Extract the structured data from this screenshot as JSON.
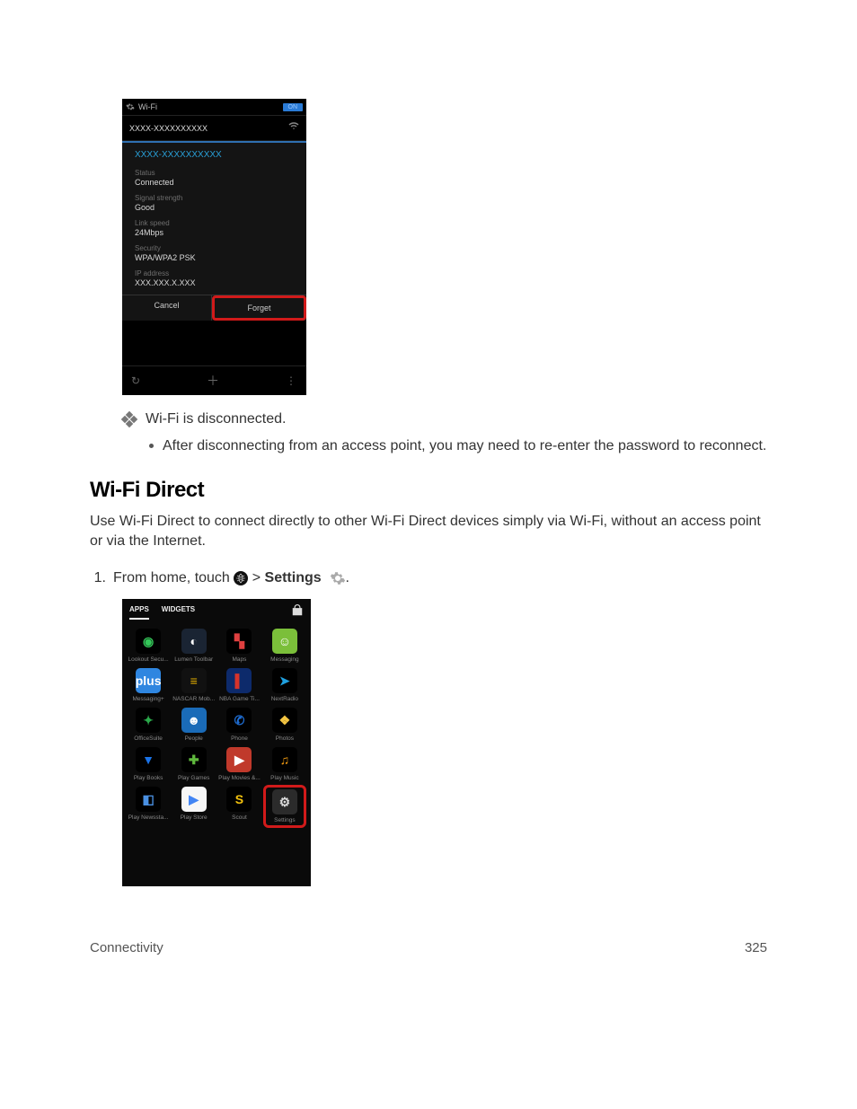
{
  "shot1": {
    "title": "Wi-Fi",
    "toggle": "ON",
    "network_name": "XXXX-XXXXXXXXXX",
    "dialog_title": "XXXX-XXXXXXXXXX",
    "fields": {
      "status_label": "Status",
      "status_value": "Connected",
      "signal_label": "Signal strength",
      "signal_value": "Good",
      "link_label": "Link speed",
      "link_value": "24Mbps",
      "security_label": "Security",
      "security_value": "WPA/WPA2 PSK",
      "ip_label": "IP address",
      "ip_value": "XXX.XXX.X.XXX"
    },
    "cancel": "Cancel",
    "forget": "Forget"
  },
  "result_text": "Wi-Fi is disconnected.",
  "bullet_text": "After disconnecting from an access point, you may need to re-enter the password to reconnect.",
  "section_heading": "Wi-Fi Direct",
  "section_para": "Use Wi-Fi Direct to connect directly to other Wi-Fi Direct devices simply via Wi-Fi, without an access point or via the Internet.",
  "step1": {
    "num": "1.",
    "pre": "From home, touch ",
    "gt": " > ",
    "settings": "Settings",
    "post": "."
  },
  "shot2": {
    "tab_apps": "APPS",
    "tab_widgets": "WIDGETS",
    "apps": [
      {
        "label": "Lookout Secu...",
        "bg": "#000",
        "fg": "#34c759",
        "glyph": "◉"
      },
      {
        "label": "Lumen Toolbar",
        "bg": "#1a2433",
        "fg": "#fff",
        "glyph": "◐"
      },
      {
        "label": "Maps",
        "bg": "#000",
        "fg": "#e04040",
        "glyph": "▚"
      },
      {
        "label": "Messaging",
        "bg": "#7bbf3a",
        "fg": "#fff",
        "glyph": "☺"
      },
      {
        "label": "Messaging+",
        "bg": "#2f86e0",
        "fg": "#fff",
        "glyph": "plus"
      },
      {
        "label": "NASCAR Mob...",
        "bg": "#111",
        "fg": "#e7b100",
        "glyph": "≡"
      },
      {
        "label": "NBA Game Ti...",
        "bg": "#0d2a6b",
        "fg": "#d7332a",
        "glyph": "▌"
      },
      {
        "label": "NextRadio",
        "bg": "#000",
        "fg": "#1fa0df",
        "glyph": "➤"
      },
      {
        "label": "OfficeSuite",
        "bg": "#000",
        "fg": "#2aa84a",
        "glyph": "✦"
      },
      {
        "label": "People",
        "bg": "#1a6bb8",
        "fg": "#fff",
        "glyph": "☻"
      },
      {
        "label": "Phone",
        "bg": "#000",
        "fg": "#1f6fd6",
        "glyph": "✆"
      },
      {
        "label": "Photos",
        "bg": "#000",
        "fg": "#f4c542",
        "glyph": "❖"
      },
      {
        "label": "Play Books",
        "bg": "#000",
        "fg": "#1a73e8",
        "glyph": "▼"
      },
      {
        "label": "Play Games",
        "bg": "#000",
        "fg": "#5fb83d",
        "glyph": "✚"
      },
      {
        "label": "Play Movies &...",
        "bg": "#c0392b",
        "fg": "#fff",
        "glyph": "▶"
      },
      {
        "label": "Play Music",
        "bg": "#000",
        "fg": "#f39c12",
        "glyph": "♫"
      },
      {
        "label": "Play Newssta...",
        "bg": "#000",
        "fg": "#4a90e2",
        "glyph": "◧"
      },
      {
        "label": "Play Store",
        "bg": "#f7f7f7",
        "fg": "#4285f4",
        "glyph": "▶"
      },
      {
        "label": "Scout",
        "bg": "#000",
        "fg": "#f4c20d",
        "glyph": "S"
      },
      {
        "label": "Settings",
        "bg": "#2b2b2b",
        "fg": "#ddd",
        "glyph": "⚙",
        "highlight": true
      }
    ]
  },
  "footer": {
    "section": "Connectivity",
    "page": "325"
  }
}
